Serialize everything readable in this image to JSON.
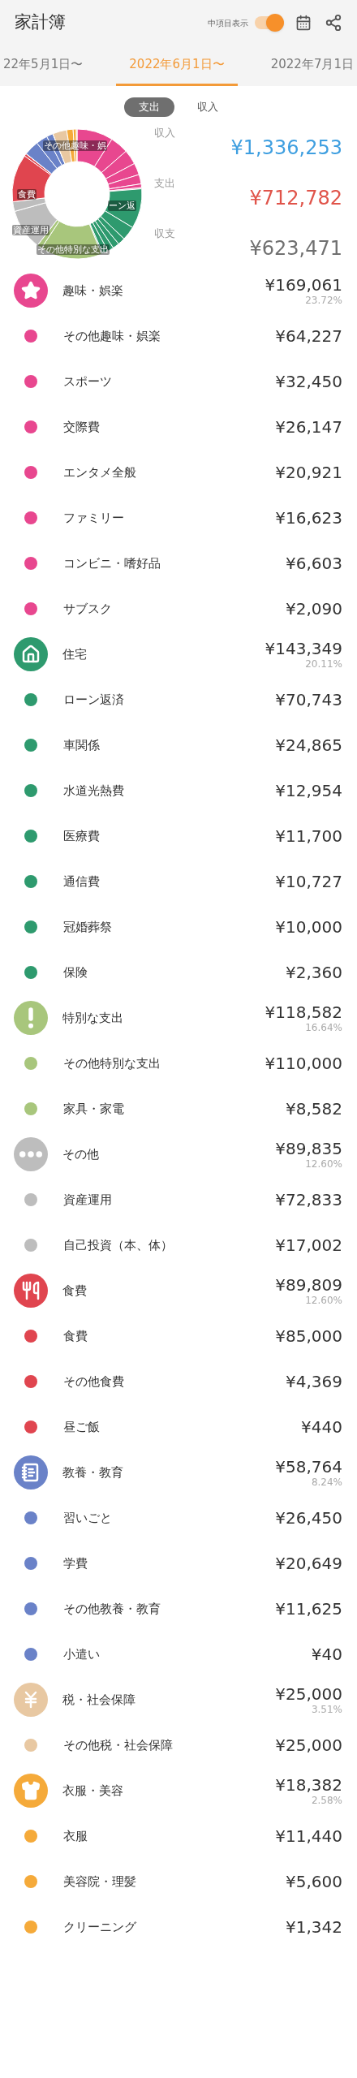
{
  "app_bar": {
    "title": "家計簿",
    "toggle": {
      "label": "中項目表示",
      "on": true
    }
  },
  "period_tabs": [
    {
      "label": "22年5月1日〜",
      "selected": false
    },
    {
      "label": "2022年6月1日〜",
      "selected": true
    },
    {
      "label": "2022年7月1日",
      "selected": false
    }
  ],
  "type_switch": [
    {
      "label": "支出",
      "selected": true
    },
    {
      "label": "収入",
      "selected": false
    }
  ],
  "donut": {
    "labels": [
      "その他趣味・娯",
      "ーン返",
      "食費",
      "資産運用",
      "その他特別な支出"
    ]
  },
  "summary": [
    {
      "label": "収入",
      "amount": "¥1,336,253",
      "color": "#3f9fe0"
    },
    {
      "label": "支出",
      "amount": "¥712,782",
      "color": "#e0544a"
    },
    {
      "label": "収支",
      "amount": "¥623,471",
      "color": "#707070"
    }
  ],
  "categories": [
    {
      "name": "趣味・娯楽",
      "amount": "¥169,061",
      "percent": "23.72%",
      "color": "#e8478f",
      "items": [
        {
          "name": "その他趣味・娯楽",
          "amount": "¥64,227"
        },
        {
          "name": "スポーツ",
          "amount": "¥32,450"
        },
        {
          "name": "交際費",
          "amount": "¥26,147"
        },
        {
          "name": "エンタメ全般",
          "amount": "¥20,921"
        },
        {
          "name": "ファミリー",
          "amount": "¥16,623"
        },
        {
          "name": "コンビニ・嗜好品",
          "amount": "¥6,603"
        },
        {
          "name": "サブスク",
          "amount": "¥2,090"
        }
      ]
    },
    {
      "name": "住宅",
      "amount": "¥143,349",
      "percent": "20.11%",
      "color": "#2e9a6e",
      "items": [
        {
          "name": "ローン返済",
          "amount": "¥70,743"
        },
        {
          "name": "車関係",
          "amount": "¥24,865"
        },
        {
          "name": "水道光熱費",
          "amount": "¥12,954"
        },
        {
          "name": "医療費",
          "amount": "¥11,700"
        },
        {
          "name": "通信費",
          "amount": "¥10,727"
        },
        {
          "name": "冠婚葬祭",
          "amount": "¥10,000"
        },
        {
          "name": "保険",
          "amount": "¥2,360"
        }
      ]
    },
    {
      "name": "特別な支出",
      "amount": "¥118,582",
      "percent": "16.64%",
      "color": "#a8c67c",
      "items": [
        {
          "name": "その他特別な支出",
          "amount": "¥110,000"
        },
        {
          "name": "家具・家電",
          "amount": "¥8,582"
        }
      ]
    },
    {
      "name": "その他",
      "amount": "¥89,835",
      "percent": "12.60%",
      "color": "#bdbdbd",
      "items": [
        {
          "name": "資産運用",
          "amount": "¥72,833"
        },
        {
          "name": "自己投資（本、体）",
          "amount": "¥17,002"
        }
      ]
    },
    {
      "name": "食費",
      "amount": "¥89,809",
      "percent": "12.60%",
      "color": "#e0454f",
      "items": [
        {
          "name": "食費",
          "amount": "¥85,000"
        },
        {
          "name": "その他食費",
          "amount": "¥4,369"
        },
        {
          "name": "昼ご飯",
          "amount": "¥440"
        }
      ]
    },
    {
      "name": "教養・教育",
      "amount": "¥58,764",
      "percent": "8.24%",
      "color": "#6a82c8",
      "items": [
        {
          "name": "習いごと",
          "amount": "¥26,450"
        },
        {
          "name": "学費",
          "amount": "¥20,649"
        },
        {
          "name": "その他教養・教育",
          "amount": "¥11,625"
        },
        {
          "name": "小遣い",
          "amount": "¥40"
        }
      ]
    },
    {
      "name": "税・社会保障",
      "amount": "¥25,000",
      "percent": "3.51%",
      "color": "#e8c8a2",
      "items": [
        {
          "name": "その他税・社会保障",
          "amount": "¥25,000"
        }
      ]
    },
    {
      "name": "衣服・美容",
      "amount": "¥18,382",
      "percent": "2.58%",
      "color": "#f5aa3a",
      "items": [
        {
          "name": "衣服",
          "amount": "¥11,440"
        },
        {
          "name": "美容院・理髪",
          "amount": "¥5,600"
        },
        {
          "name": "クリーニング",
          "amount": "¥1,342"
        }
      ]
    }
  ]
}
